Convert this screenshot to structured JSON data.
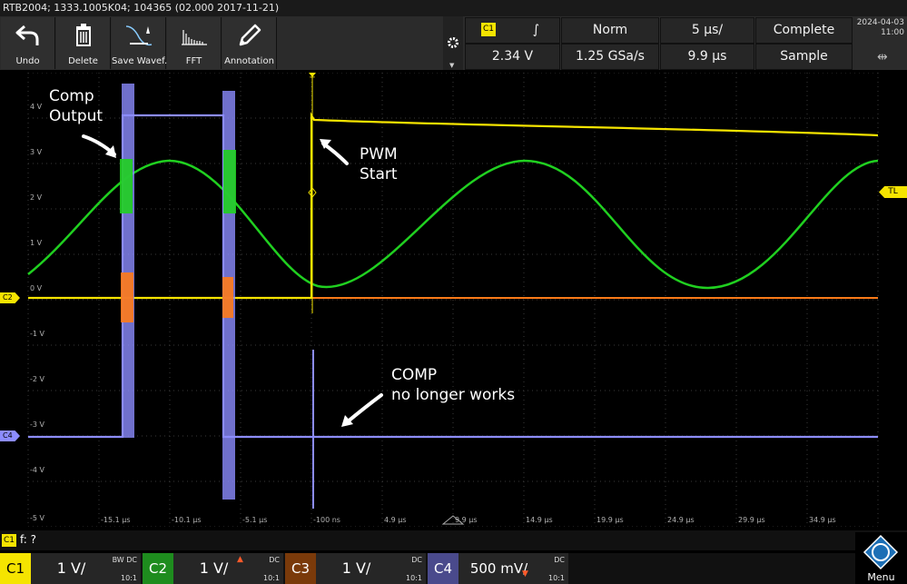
{
  "titlebar": {
    "text": "RTB2004; 1333.1005K04; 104365 (02.000 2017-11-21)"
  },
  "toolbar": {
    "buttons": [
      {
        "label": "Undo",
        "icon": "undo-icon"
      },
      {
        "label": "Delete",
        "icon": "trash-icon"
      },
      {
        "label": "Save Wavef.",
        "icon": "save-waveform-icon"
      },
      {
        "label": "FFT",
        "icon": "fft-icon"
      },
      {
        "label": "Annotation",
        "icon": "pencil-icon"
      }
    ]
  },
  "trigger": {
    "source": "C1",
    "slope_symbol": "∫",
    "mode": "Norm",
    "timebase": "5 µs/",
    "acquire": "Complete",
    "level": "2.34 V",
    "samplerate": "1.25 GSa/s",
    "position": "9.9 µs",
    "acq_mode": "Sample"
  },
  "datetime": {
    "date": "2024-04-03",
    "time": "11:00"
  },
  "grid": {
    "y_labels": [
      "4 V",
      "3 V",
      "2 V",
      "1 V",
      "0 V",
      "-1 V",
      "-2 V",
      "-3 V",
      "-4 V",
      "-5 V"
    ],
    "x_labels": [
      "-15.1 µs",
      "-10.1 µs",
      "-5.1 µs",
      "-100 ns",
      "4.9 µs",
      "9.9 µs",
      "14.9 µs",
      "19.9 µs",
      "24.9 µs",
      "29.9 µs",
      "34.9 µs"
    ],
    "trigger_marker": "T",
    "trigger_level_marker": "TL",
    "markers": {
      "c2": "C2",
      "c4": "C4"
    }
  },
  "annotations": {
    "comp_output_1": "Comp",
    "comp_output_2": "Output",
    "pwm_1": "PWM",
    "pwm_2": "Start",
    "comp_nw_1": "COMP",
    "comp_nw_2": "no longer works"
  },
  "statusline": {
    "channel": "C1",
    "text": "f: ?"
  },
  "channels": [
    {
      "tag": "C1",
      "scale": "1 V/",
      "coupling": "DC",
      "bw": "BW",
      "attenuation": "10:1",
      "color": "#f5e400"
    },
    {
      "tag": "C2",
      "scale": "1 V/",
      "coupling": "DC",
      "attenuation": "10:1",
      "color": "#20d020"
    },
    {
      "tag": "C3",
      "scale": "1 V/",
      "coupling": "DC",
      "attenuation": "10:1",
      "color": "#ff7a18"
    },
    {
      "tag": "C4",
      "scale": "500 mV/",
      "coupling": "DC",
      "attenuation": "10:1",
      "color": "#8c8cff"
    }
  ],
  "menu": {
    "label": "Menu"
  },
  "colors": {
    "c1": "#f5e400",
    "c2": "#20d020",
    "c3": "#ff7a18",
    "c4": "#8c8cff",
    "grid": "#3a3a3a"
  }
}
